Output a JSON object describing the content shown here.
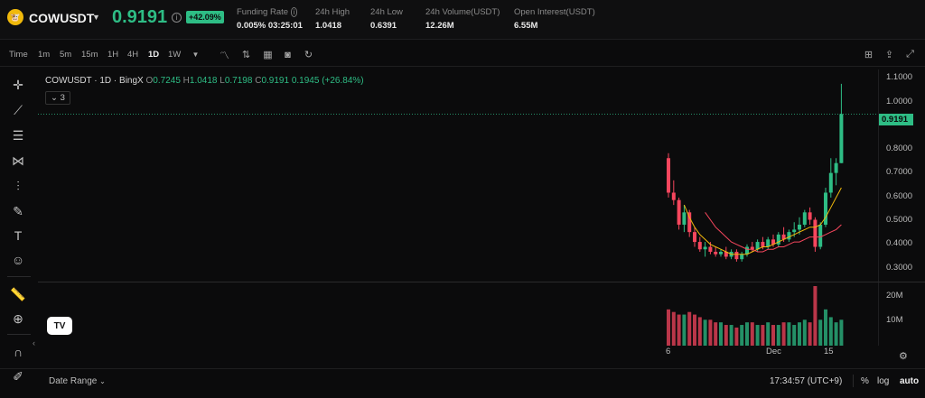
{
  "header": {
    "logo_text": "🐮",
    "symbol": "COWUSDT",
    "price": "0.9191",
    "change_badge": "+42.09%",
    "stats": [
      {
        "label": "Funding Rate",
        "value": "0.005% 03:25:01"
      },
      {
        "label": "24h High",
        "value": "1.0418"
      },
      {
        "label": "24h Low",
        "value": "0.6391"
      },
      {
        "label": "24h Volume(USDT)",
        "value": "12.26M"
      },
      {
        "label": "Open Interest(USDT)",
        "value": "6.55M"
      }
    ],
    "colors": {
      "up": "#2ebd85",
      "down": "#f6465d",
      "brand": "#f0b90b"
    }
  },
  "toolbar": {
    "intervals": [
      "Time",
      "1m",
      "5m",
      "15m",
      "1H",
      "4H",
      "1D",
      "1W"
    ],
    "active_interval": "1D",
    "tool_icons": [
      "chevron-down-icon",
      "indicators-icon",
      "compare-icon",
      "template-icon",
      "camera-icon",
      "undo-icon"
    ],
    "right_icons": [
      "layout-icon",
      "share-icon",
      "fullscreen-icon"
    ]
  },
  "left_tools": [
    "crosshair-icon",
    "trendline-icon",
    "fib-icon",
    "pattern-icon",
    "measure-icon",
    "brush-icon",
    "text-icon",
    "emoji-icon",
    "ruler-icon",
    "zoom-icon",
    "magnet-icon",
    "lock-icon"
  ],
  "legend": {
    "title": "COWUSDT · 1D · BingX",
    "open_label": "O",
    "open": "0.7245",
    "high_label": "H",
    "high": "1.0418",
    "low_label": "L",
    "low": "0.7198",
    "close_label": "C",
    "close": "0.9191",
    "change": "0.1945 (+26.84%)",
    "indicators_count": "3"
  },
  "chart_data": {
    "type": "candlestick",
    "x_ticks": [
      "6",
      "Dec",
      "15"
    ],
    "price_axis": [
      "1.1000",
      "1.0000",
      "0.9191",
      "0.8000",
      "0.7000",
      "0.6000",
      "0.5000",
      "0.4000",
      "0.3000"
    ],
    "volume_axis": [
      "20M",
      "10M"
    ],
    "last_price": 0.9191,
    "ylim": [
      0.25,
      1.1
    ],
    "candles": [
      [
        0.74,
        0.76,
        0.58,
        0.6
      ],
      [
        0.6,
        0.65,
        0.55,
        0.57
      ],
      [
        0.57,
        0.58,
        0.45,
        0.47
      ],
      [
        0.47,
        0.55,
        0.44,
        0.52
      ],
      [
        0.52,
        0.53,
        0.42,
        0.44
      ],
      [
        0.44,
        0.46,
        0.38,
        0.4
      ],
      [
        0.4,
        0.42,
        0.36,
        0.37
      ],
      [
        0.37,
        0.4,
        0.34,
        0.38
      ],
      [
        0.38,
        0.4,
        0.35,
        0.36
      ],
      [
        0.36,
        0.38,
        0.34,
        0.35
      ],
      [
        0.35,
        0.37,
        0.34,
        0.36
      ],
      [
        0.36,
        0.38,
        0.33,
        0.34
      ],
      [
        0.34,
        0.37,
        0.33,
        0.36
      ],
      [
        0.36,
        0.37,
        0.32,
        0.33
      ],
      [
        0.33,
        0.36,
        0.32,
        0.35
      ],
      [
        0.35,
        0.39,
        0.34,
        0.38
      ],
      [
        0.38,
        0.4,
        0.36,
        0.37
      ],
      [
        0.37,
        0.41,
        0.36,
        0.4
      ],
      [
        0.4,
        0.42,
        0.37,
        0.38
      ],
      [
        0.38,
        0.42,
        0.37,
        0.41
      ],
      [
        0.41,
        0.43,
        0.38,
        0.39
      ],
      [
        0.39,
        0.44,
        0.38,
        0.43
      ],
      [
        0.43,
        0.46,
        0.4,
        0.41
      ],
      [
        0.41,
        0.45,
        0.4,
        0.44
      ],
      [
        0.44,
        0.48,
        0.42,
        0.45
      ],
      [
        0.45,
        0.5,
        0.43,
        0.47
      ],
      [
        0.47,
        0.53,
        0.46,
        0.52
      ],
      [
        0.52,
        0.54,
        0.47,
        0.49
      ],
      [
        0.49,
        0.5,
        0.36,
        0.38
      ],
      [
        0.38,
        0.48,
        0.37,
        0.47
      ],
      [
        0.47,
        0.62,
        0.46,
        0.6
      ],
      [
        0.6,
        0.74,
        0.58,
        0.68
      ],
      [
        0.68,
        0.74,
        0.63,
        0.72
      ],
      [
        0.72,
        1.0418,
        0.7198,
        0.9191
      ]
    ],
    "volumes": [
      14,
      13,
      12,
      12,
      13,
      12,
      11,
      10,
      10,
      9,
      9,
      8,
      8,
      7,
      8,
      9,
      9,
      8,
      8,
      9,
      8,
      8,
      9,
      9,
      8,
      9,
      10,
      9,
      23,
      10,
      14,
      11,
      9,
      10
    ],
    "ma_series": [
      {
        "color": "#f0b90b",
        "values": [
          null,
          null,
          null,
          0.55,
          0.5,
          0.46,
          0.43,
          0.41,
          0.39,
          0.38,
          0.37,
          0.36,
          0.35,
          0.35,
          0.35,
          0.35,
          0.36,
          0.37,
          0.38,
          0.38,
          0.39,
          0.4,
          0.41,
          0.42,
          0.43,
          0.44,
          0.45,
          0.46,
          0.46,
          0.47,
          0.5,
          0.54,
          0.58,
          0.62
        ]
      },
      {
        "color": "#f6465d",
        "values": [
          null,
          null,
          null,
          null,
          null,
          null,
          null,
          0.52,
          0.49,
          0.46,
          0.44,
          0.42,
          0.4,
          0.39,
          0.38,
          0.37,
          0.37,
          0.36,
          0.36,
          0.37,
          0.37,
          0.38,
          0.38,
          0.39,
          0.4,
          0.4,
          0.41,
          0.42,
          0.42,
          0.42,
          0.43,
          0.44,
          0.45,
          0.47
        ]
      }
    ]
  },
  "bottom": {
    "date_range": "Date Range",
    "time": "17:34:57 (UTC+9)",
    "percent": "%",
    "log": "log",
    "auto": "auto"
  }
}
